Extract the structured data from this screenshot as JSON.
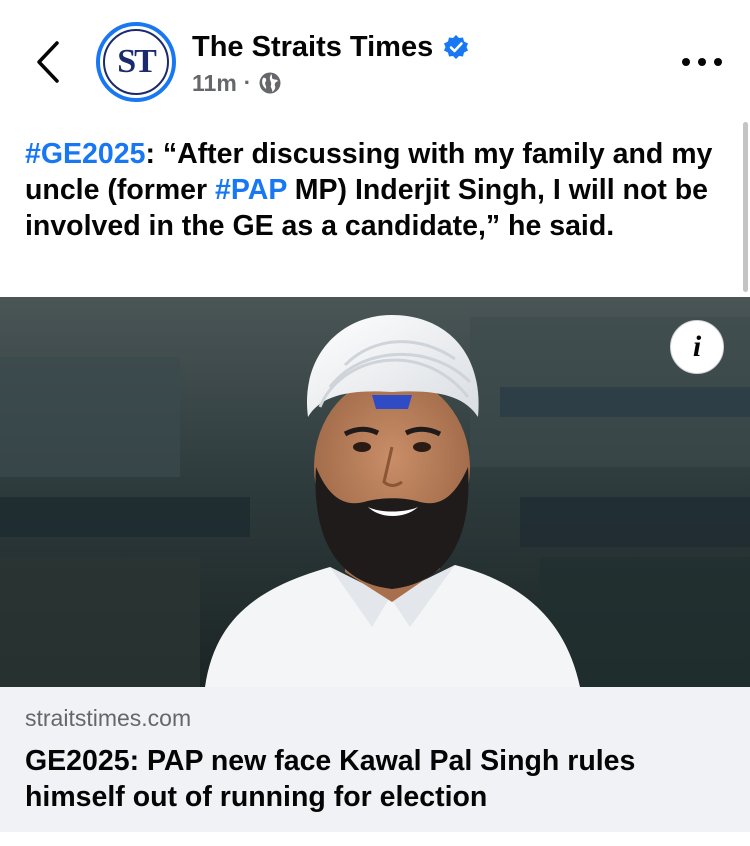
{
  "header": {
    "page_name": "The Straits Times",
    "avatar_text": "ST",
    "time": "11m",
    "separator": "·",
    "icons": {
      "back": "chevron-left-icon",
      "verified": "verified-badge-icon",
      "audience": "globe-icon",
      "more": "more-horizontal-icon"
    },
    "colors": {
      "verified": "#1877f2",
      "hashtag": "#1877f2"
    }
  },
  "post": {
    "hashtag_1": "#GE2025",
    "text_1": ": “After discussing with my family and my uncle (former ",
    "hashtag_2": "#PAP",
    "text_2": " MP) Inderjit Singh, I will not be involved in the GE as a candidate,” he said."
  },
  "photo": {
    "info_label": "i",
    "info_icon": "info-icon"
  },
  "link_card": {
    "domain": "straitstimes.com",
    "title": "GE2025: PAP new face Kawal Pal Singh rules himself out of running for election"
  }
}
